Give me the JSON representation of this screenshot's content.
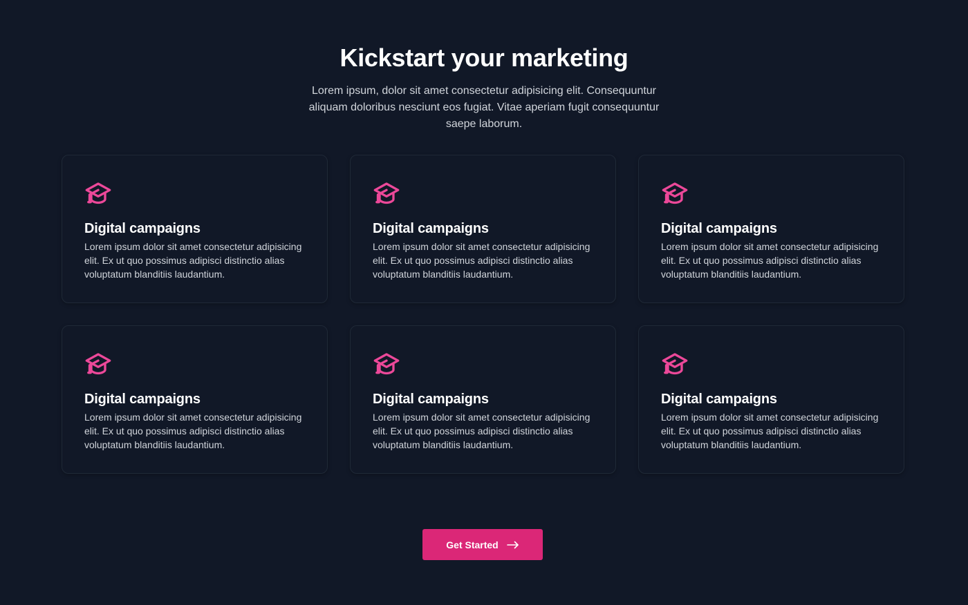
{
  "header": {
    "title": "Kickstart your marketing",
    "subtitle": "Lorem ipsum, dolor sit amet consectetur adipisicing elit. Consequuntur aliquam doloribus nesciunt eos fugiat. Vitae aperiam fugit consequuntur saepe laborum."
  },
  "colors": {
    "background": "#111827",
    "accent": "#db2777",
    "icon": "#ec4899"
  },
  "cards": [
    {
      "icon": "graduation-cap-icon",
      "title": "Digital campaigns",
      "text": "Lorem ipsum dolor sit amet consectetur adipisicing elit. Ex ut quo possimus adipisci distinctio alias voluptatum blanditiis laudantium."
    },
    {
      "icon": "graduation-cap-icon",
      "title": "Digital campaigns",
      "text": "Lorem ipsum dolor sit amet consectetur adipisicing elit. Ex ut quo possimus adipisci distinctio alias voluptatum blanditiis laudantium."
    },
    {
      "icon": "graduation-cap-icon",
      "title": "Digital campaigns",
      "text": "Lorem ipsum dolor sit amet consectetur adipisicing elit. Ex ut quo possimus adipisci distinctio alias voluptatum blanditiis laudantium."
    },
    {
      "icon": "graduation-cap-icon",
      "title": "Digital campaigns",
      "text": "Lorem ipsum dolor sit amet consectetur adipisicing elit. Ex ut quo possimus adipisci distinctio alias voluptatum blanditiis laudantium."
    },
    {
      "icon": "graduation-cap-icon",
      "title": "Digital campaigns",
      "text": "Lorem ipsum dolor sit amet consectetur adipisicing elit. Ex ut quo possimus adipisci distinctio alias voluptatum blanditiis laudantium."
    },
    {
      "icon": "graduation-cap-icon",
      "title": "Digital campaigns",
      "text": "Lorem ipsum dolor sit amet consectetur adipisicing elit. Ex ut quo possimus adipisci distinctio alias voluptatum blanditiis laudantium."
    }
  ],
  "cta": {
    "label": "Get Started",
    "icon": "arrow-right-icon"
  }
}
